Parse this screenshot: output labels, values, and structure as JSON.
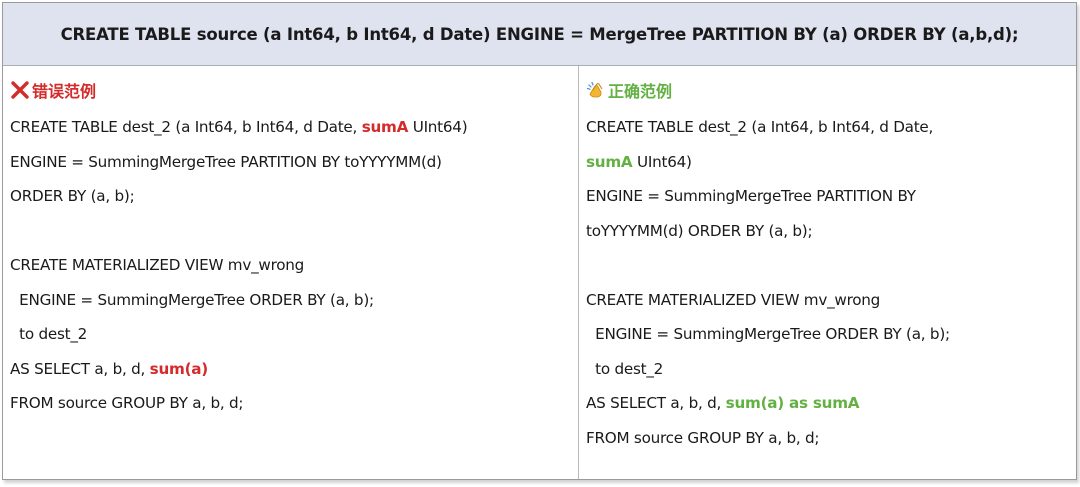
{
  "header": {
    "statement": "CREATE TABLE source (a Int64, b Int64, d Date) ENGINE = MergeTree PARTITION BY (a) ORDER BY (a,b,d);"
  },
  "wrong": {
    "heading": "错误范例",
    "icon": "red-x-icon",
    "lines": [
      [
        "CREATE TABLE dest_2 (a Int64, b Int64, d Date, ",
        "sumA",
        " UInt64)"
      ],
      [
        "ENGINE = SummingMergeTree PARTITION BY toYYYYMM(d)"
      ],
      [
        "ORDER BY (a, b);"
      ],
      [
        ""
      ],
      [
        "CREATE MATERIALIZED VIEW mv_wrong"
      ],
      [
        "  ENGINE = SummingMergeTree ORDER BY (a, b);"
      ],
      [
        "  to dest_2"
      ],
      [
        "AS SELECT a, b, d, ",
        "sum(a)",
        ""
      ],
      [
        "FROM source GROUP BY a, b, d;"
      ]
    ]
  },
  "right": {
    "heading": "正确范例",
    "icon": "clapping-hands-icon",
    "lines": [
      [
        "CREATE TABLE dest_2 (a Int64, b Int64, d Date,"
      ],
      [
        "",
        "sumA",
        " UInt64)"
      ],
      [
        "ENGINE = SummingMergeTree PARTITION BY"
      ],
      [
        "toYYYYMM(d) ORDER BY (a, b);"
      ],
      [
        ""
      ],
      [
        "CREATE MATERIALIZED VIEW mv_wrong"
      ],
      [
        "  ENGINE = SummingMergeTree ORDER BY (a, b);"
      ],
      [
        "  to dest_2"
      ],
      [
        "AS SELECT a, b, d, ",
        "sum(a) as sumA",
        ""
      ],
      [
        "FROM source GROUP BY a, b, d;"
      ]
    ]
  },
  "colors": {
    "header_bg": "#dfe3f0",
    "wrong_accent": "#d42b2b",
    "right_accent": "#63b043"
  }
}
